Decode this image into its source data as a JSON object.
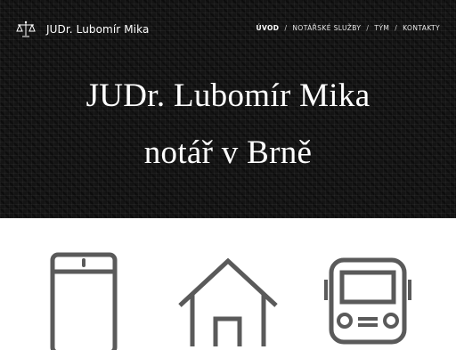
{
  "header": {
    "logo_text": "JUDr. Lubomír Mika",
    "logo_icon": "scales-icon"
  },
  "nav": {
    "items": [
      {
        "label": "úvod",
        "active": true
      },
      {
        "label": "notářské služby",
        "active": false
      },
      {
        "label": "tým",
        "active": false
      },
      {
        "label": "kontakty",
        "active": false
      }
    ],
    "separator": "/"
  },
  "hero": {
    "title_line1": "JUDr. Lubomír Mika",
    "title_line2": "notář v Brně"
  },
  "features": {
    "icons": [
      "phone-icon",
      "house-icon",
      "bus-icon"
    ]
  },
  "colors": {
    "hero_background": "#141414",
    "icon_stroke": "#5a5a5a",
    "text_light": "#ffffff"
  }
}
